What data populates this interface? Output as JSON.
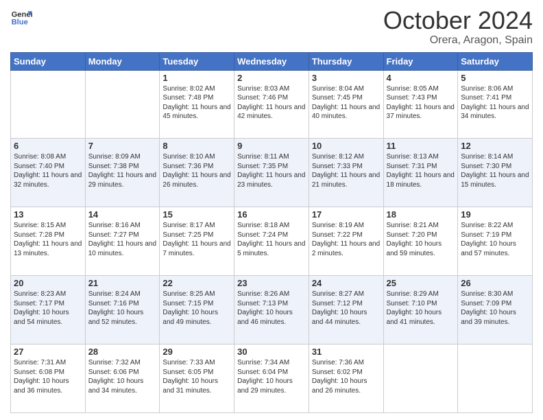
{
  "logo": {
    "line1": "General",
    "line2": "Blue"
  },
  "header": {
    "month": "October 2024",
    "location": "Orera, Aragon, Spain"
  },
  "weekdays": [
    "Sunday",
    "Monday",
    "Tuesday",
    "Wednesday",
    "Thursday",
    "Friday",
    "Saturday"
  ],
  "weeks": [
    [
      {
        "day": "",
        "info": ""
      },
      {
        "day": "",
        "info": ""
      },
      {
        "day": "1",
        "info": "Sunrise: 8:02 AM\nSunset: 7:48 PM\nDaylight: 11 hours and 45 minutes."
      },
      {
        "day": "2",
        "info": "Sunrise: 8:03 AM\nSunset: 7:46 PM\nDaylight: 11 hours and 42 minutes."
      },
      {
        "day": "3",
        "info": "Sunrise: 8:04 AM\nSunset: 7:45 PM\nDaylight: 11 hours and 40 minutes."
      },
      {
        "day": "4",
        "info": "Sunrise: 8:05 AM\nSunset: 7:43 PM\nDaylight: 11 hours and 37 minutes."
      },
      {
        "day": "5",
        "info": "Sunrise: 8:06 AM\nSunset: 7:41 PM\nDaylight: 11 hours and 34 minutes."
      }
    ],
    [
      {
        "day": "6",
        "info": "Sunrise: 8:08 AM\nSunset: 7:40 PM\nDaylight: 11 hours and 32 minutes."
      },
      {
        "day": "7",
        "info": "Sunrise: 8:09 AM\nSunset: 7:38 PM\nDaylight: 11 hours and 29 minutes."
      },
      {
        "day": "8",
        "info": "Sunrise: 8:10 AM\nSunset: 7:36 PM\nDaylight: 11 hours and 26 minutes."
      },
      {
        "day": "9",
        "info": "Sunrise: 8:11 AM\nSunset: 7:35 PM\nDaylight: 11 hours and 23 minutes."
      },
      {
        "day": "10",
        "info": "Sunrise: 8:12 AM\nSunset: 7:33 PM\nDaylight: 11 hours and 21 minutes."
      },
      {
        "day": "11",
        "info": "Sunrise: 8:13 AM\nSunset: 7:31 PM\nDaylight: 11 hours and 18 minutes."
      },
      {
        "day": "12",
        "info": "Sunrise: 8:14 AM\nSunset: 7:30 PM\nDaylight: 11 hours and 15 minutes."
      }
    ],
    [
      {
        "day": "13",
        "info": "Sunrise: 8:15 AM\nSunset: 7:28 PM\nDaylight: 11 hours and 13 minutes."
      },
      {
        "day": "14",
        "info": "Sunrise: 8:16 AM\nSunset: 7:27 PM\nDaylight: 11 hours and 10 minutes."
      },
      {
        "day": "15",
        "info": "Sunrise: 8:17 AM\nSunset: 7:25 PM\nDaylight: 11 hours and 7 minutes."
      },
      {
        "day": "16",
        "info": "Sunrise: 8:18 AM\nSunset: 7:24 PM\nDaylight: 11 hours and 5 minutes."
      },
      {
        "day": "17",
        "info": "Sunrise: 8:19 AM\nSunset: 7:22 PM\nDaylight: 11 hours and 2 minutes."
      },
      {
        "day": "18",
        "info": "Sunrise: 8:21 AM\nSunset: 7:20 PM\nDaylight: 10 hours and 59 minutes."
      },
      {
        "day": "19",
        "info": "Sunrise: 8:22 AM\nSunset: 7:19 PM\nDaylight: 10 hours and 57 minutes."
      }
    ],
    [
      {
        "day": "20",
        "info": "Sunrise: 8:23 AM\nSunset: 7:17 PM\nDaylight: 10 hours and 54 minutes."
      },
      {
        "day": "21",
        "info": "Sunrise: 8:24 AM\nSunset: 7:16 PM\nDaylight: 10 hours and 52 minutes."
      },
      {
        "day": "22",
        "info": "Sunrise: 8:25 AM\nSunset: 7:15 PM\nDaylight: 10 hours and 49 minutes."
      },
      {
        "day": "23",
        "info": "Sunrise: 8:26 AM\nSunset: 7:13 PM\nDaylight: 10 hours and 46 minutes."
      },
      {
        "day": "24",
        "info": "Sunrise: 8:27 AM\nSunset: 7:12 PM\nDaylight: 10 hours and 44 minutes."
      },
      {
        "day": "25",
        "info": "Sunrise: 8:29 AM\nSunset: 7:10 PM\nDaylight: 10 hours and 41 minutes."
      },
      {
        "day": "26",
        "info": "Sunrise: 8:30 AM\nSunset: 7:09 PM\nDaylight: 10 hours and 39 minutes."
      }
    ],
    [
      {
        "day": "27",
        "info": "Sunrise: 7:31 AM\nSunset: 6:08 PM\nDaylight: 10 hours and 36 minutes."
      },
      {
        "day": "28",
        "info": "Sunrise: 7:32 AM\nSunset: 6:06 PM\nDaylight: 10 hours and 34 minutes."
      },
      {
        "day": "29",
        "info": "Sunrise: 7:33 AM\nSunset: 6:05 PM\nDaylight: 10 hours and 31 minutes."
      },
      {
        "day": "30",
        "info": "Sunrise: 7:34 AM\nSunset: 6:04 PM\nDaylight: 10 hours and 29 minutes."
      },
      {
        "day": "31",
        "info": "Sunrise: 7:36 AM\nSunset: 6:02 PM\nDaylight: 10 hours and 26 minutes."
      },
      {
        "day": "",
        "info": ""
      },
      {
        "day": "",
        "info": ""
      }
    ]
  ]
}
